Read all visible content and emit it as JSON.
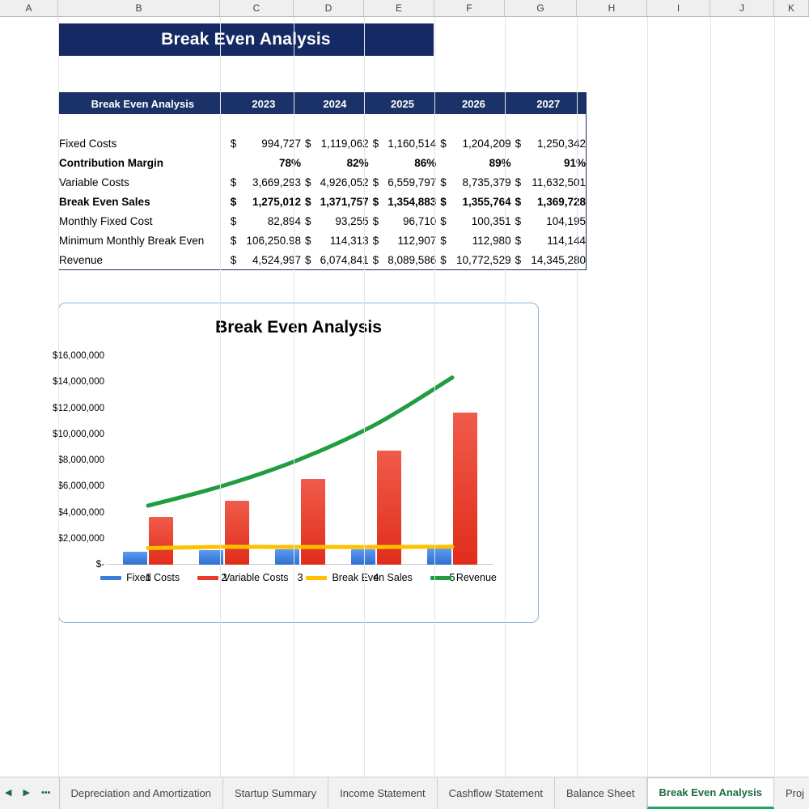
{
  "spreadsheet": {
    "column_headers": [
      "A",
      "B",
      "C",
      "D",
      "E",
      "F",
      "G",
      "H",
      "I",
      "J",
      "K"
    ],
    "title_banner": "Break Even Analysis"
  },
  "table": {
    "corner_label": "Break Even Analysis",
    "years": [
      "2023",
      "2024",
      "2025",
      "2026",
      "2027"
    ],
    "currency_symbol": "$",
    "rows": [
      {
        "label": "Fixed Costs",
        "bold": false,
        "currency": true,
        "values": [
          "994,727",
          "1,119,062",
          "1,160,514",
          "1,204,209",
          "1,250,342"
        ]
      },
      {
        "label": "Contribution Margin",
        "bold": true,
        "currency": false,
        "values": [
          "78%",
          "82%",
          "86%",
          "89%",
          "91%"
        ]
      },
      {
        "label": "Variable Costs",
        "bold": false,
        "currency": true,
        "values": [
          "3,669,293",
          "4,926,052",
          "6,559,797",
          "8,735,379",
          "11,632,501"
        ]
      },
      {
        "label": "Break Even Sales",
        "bold": true,
        "currency": true,
        "values": [
          "1,275,012",
          "1,371,757",
          "1,354,883",
          "1,355,764",
          "1,369,728"
        ]
      },
      {
        "label": "Monthly Fixed Cost",
        "bold": false,
        "currency": true,
        "values": [
          "82,894",
          "93,255",
          "96,710",
          "100,351",
          "104,195"
        ]
      },
      {
        "label": "Minimum Monthly Break Even",
        "bold": false,
        "currency": true,
        "values": [
          "106,250.98",
          "114,313",
          "112,907",
          "112,980",
          "114,144"
        ]
      },
      {
        "label": "Revenue",
        "bold": false,
        "currency": true,
        "values": [
          "4,524,997",
          "6,074,841",
          "8,089,586",
          "10,772,529",
          "14,345,280"
        ]
      }
    ]
  },
  "chart_data": {
    "type": "bar",
    "title": "Break Even Analysis",
    "xlabel": "",
    "ylabel": "",
    "categories": [
      "1",
      "2",
      "3",
      "4",
      "5"
    ],
    "ylim": [
      0,
      16000000
    ],
    "ytick_labels": [
      "$16,000,000",
      "$14,000,000",
      "$12,000,000",
      "$10,000,000",
      "$8,000,000",
      "$6,000,000",
      "$4,000,000",
      "$2,000,000",
      "$-"
    ],
    "ytick_values": [
      16000000,
      14000000,
      12000000,
      10000000,
      8000000,
      6000000,
      4000000,
      2000000,
      0
    ],
    "grid": false,
    "legend_position": "bottom",
    "series": [
      {
        "name": "Fixed Costs",
        "type": "bar",
        "color": "#3b7dd8",
        "values": [
          994727,
          1119062,
          1160514,
          1204209,
          1250342
        ]
      },
      {
        "name": "Variable Costs",
        "type": "bar",
        "color": "#e8392a",
        "values": [
          3669293,
          4926052,
          6559797,
          8735379,
          11632501
        ]
      },
      {
        "name": "Break Even Sales",
        "type": "line",
        "color": "#ffc000",
        "values": [
          1275012,
          1371757,
          1354883,
          1355764,
          1369728
        ]
      },
      {
        "name": "Revenue",
        "type": "line",
        "color": "#1f9d3f",
        "values": [
          4524997,
          6074841,
          8089586,
          10772529,
          14345280
        ]
      }
    ]
  },
  "tabbar": {
    "nav": {
      "prev": "◀",
      "next": "▶",
      "more": "•••"
    },
    "tabs": [
      {
        "label": "Depreciation and Amortization",
        "active": false
      },
      {
        "label": "Startup Summary",
        "active": false
      },
      {
        "label": "Income Statement",
        "active": false
      },
      {
        "label": "Cashflow Statement",
        "active": false
      },
      {
        "label": "Balance Sheet",
        "active": false
      },
      {
        "label": "Break Even Analysis",
        "active": true
      },
      {
        "label": "Proj",
        "active": false
      }
    ]
  }
}
